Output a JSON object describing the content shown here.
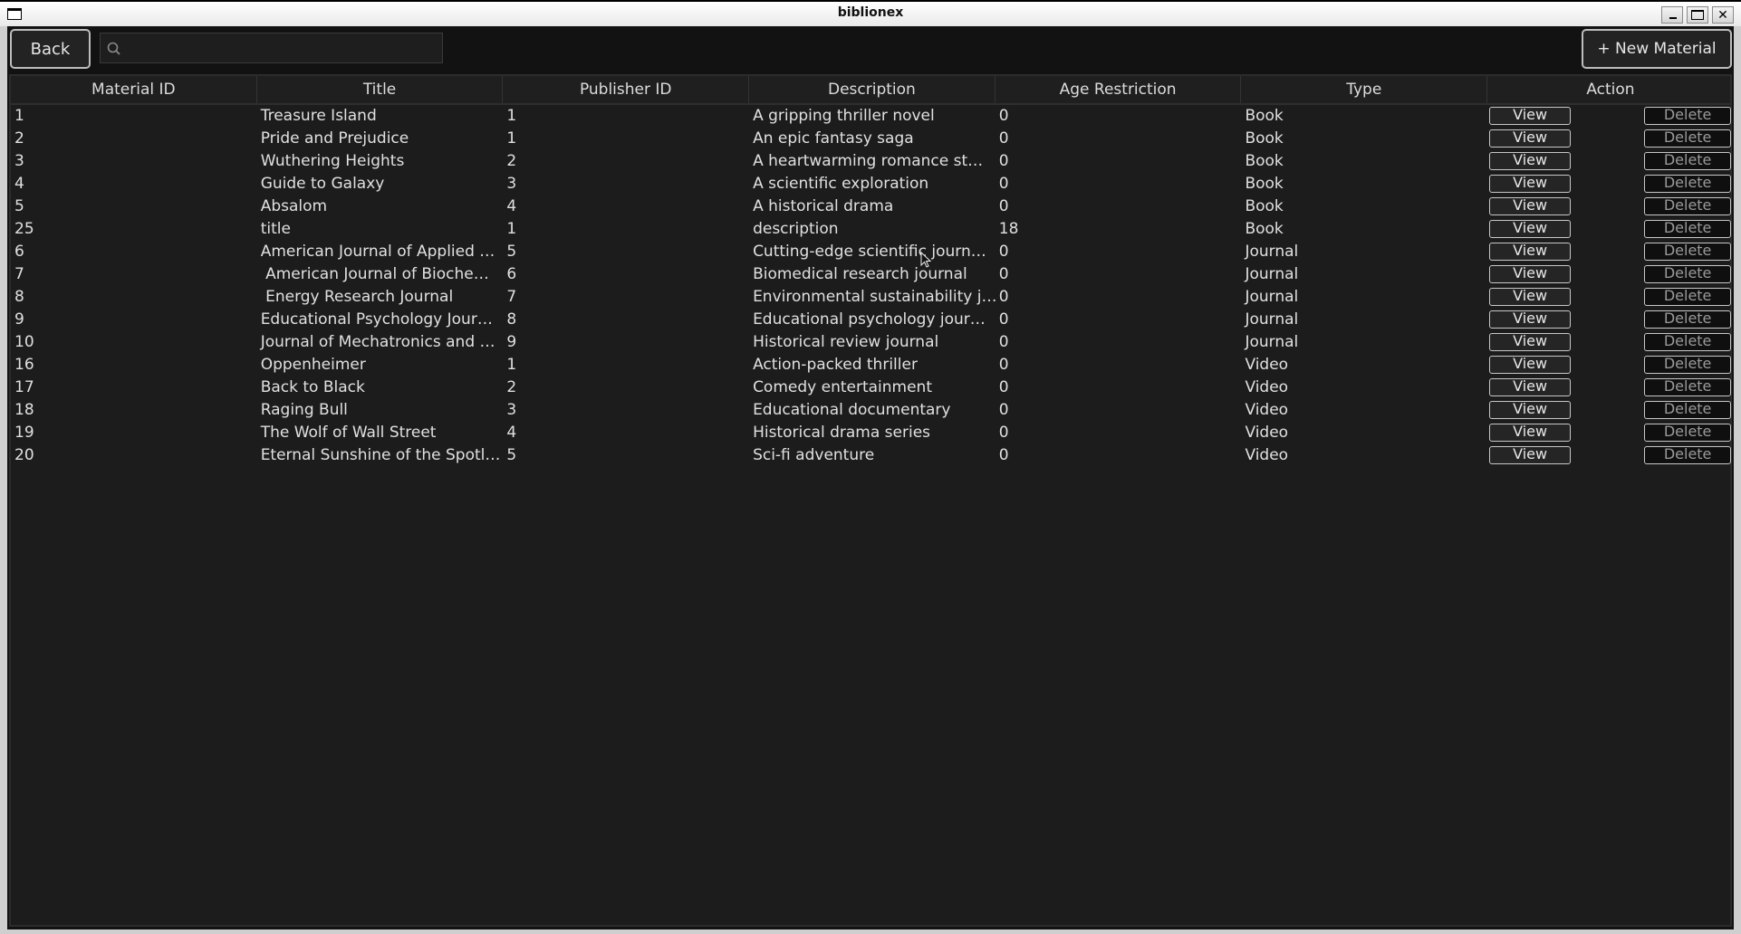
{
  "window": {
    "title": "biblionex",
    "controls": {
      "minimize": "minimize",
      "maximize": "maximize",
      "close": "✕"
    }
  },
  "toolbar": {
    "back_label": "Back",
    "search": {
      "value": "",
      "placeholder": "",
      "icon": "search-icon"
    },
    "new_material_label": "+ New Material"
  },
  "table": {
    "columns": [
      "Material ID",
      "Title",
      "Publisher ID",
      "Description",
      "Age Restriction",
      "Type",
      "Action"
    ],
    "view_label": "View",
    "delete_label": "Delete",
    "rows": [
      {
        "id": "1",
        "title": "Treasure Island",
        "publisher_id": "1",
        "description": "A gripping thriller novel",
        "age": "0",
        "type": "Book"
      },
      {
        "id": "2",
        "title": "Pride and Prejudice",
        "publisher_id": "1",
        "description": "An epic fantasy saga",
        "age": "0",
        "type": "Book"
      },
      {
        "id": "3",
        "title": "Wuthering Heights",
        "publisher_id": "2",
        "description": "A heartwarming romance st…",
        "age": "0",
        "type": "Book"
      },
      {
        "id": "4",
        "title": "Guide to Galaxy",
        "publisher_id": "3",
        "description": "A scientific exploration",
        "age": "0",
        "type": "Book"
      },
      {
        "id": "5",
        "title": "Absalom",
        "publisher_id": "4",
        "description": "A historical drama",
        "age": "0",
        "type": "Book"
      },
      {
        "id": "25",
        "title": "title",
        "publisher_id": "1",
        "description": "description",
        "age": "18",
        "type": "Book"
      },
      {
        "id": "6",
        "title": "American Journal of Applied …",
        "publisher_id": "5",
        "description": "Cutting-edge scientific journ…",
        "age": "0",
        "type": "Journal"
      },
      {
        "id": "7",
        "title": " American Journal of Bioche…",
        "publisher_id": "6",
        "description": "Biomedical research journal",
        "age": "0",
        "type": "Journal"
      },
      {
        "id": "8",
        "title": " Energy Research Journal",
        "publisher_id": "7",
        "description": "Environmental sustainability j…",
        "age": "0",
        "type": "Journal"
      },
      {
        "id": "9",
        "title": "Educational Psychology Jour…",
        "publisher_id": "8",
        "description": "Educational psychology jour…",
        "age": "0",
        "type": "Journal"
      },
      {
        "id": "10",
        "title": "Journal of Mechatronics and …",
        "publisher_id": "9",
        "description": "Historical review journal",
        "age": "0",
        "type": "Journal"
      },
      {
        "id": "16",
        "title": "Oppenheimer",
        "publisher_id": "1",
        "description": "Action-packed thriller",
        "age": "0",
        "type": "Video"
      },
      {
        "id": "17",
        "title": "Back to Black",
        "publisher_id": "2",
        "description": "Comedy entertainment",
        "age": "0",
        "type": "Video"
      },
      {
        "id": "18",
        "title": "Raging Bull",
        "publisher_id": "3",
        "description": "Educational documentary",
        "age": "0",
        "type": "Video"
      },
      {
        "id": "19",
        "title": "The Wolf of Wall Street",
        "publisher_id": "4",
        "description": "Historical drama series",
        "age": "0",
        "type": "Video"
      },
      {
        "id": "20",
        "title": "Eternal Sunshine of the Spotl…",
        "publisher_id": "5",
        "description": "Sci-fi adventure",
        "age": "0",
        "type": "Video"
      }
    ]
  },
  "colors": {
    "background": "#121212",
    "table_bg": "#1c1c1c",
    "text": "#e0e0e0",
    "button_border": "#c8c8c8",
    "delete_bg": "#0f0f0f",
    "delete_text": "#9a9a9a"
  }
}
